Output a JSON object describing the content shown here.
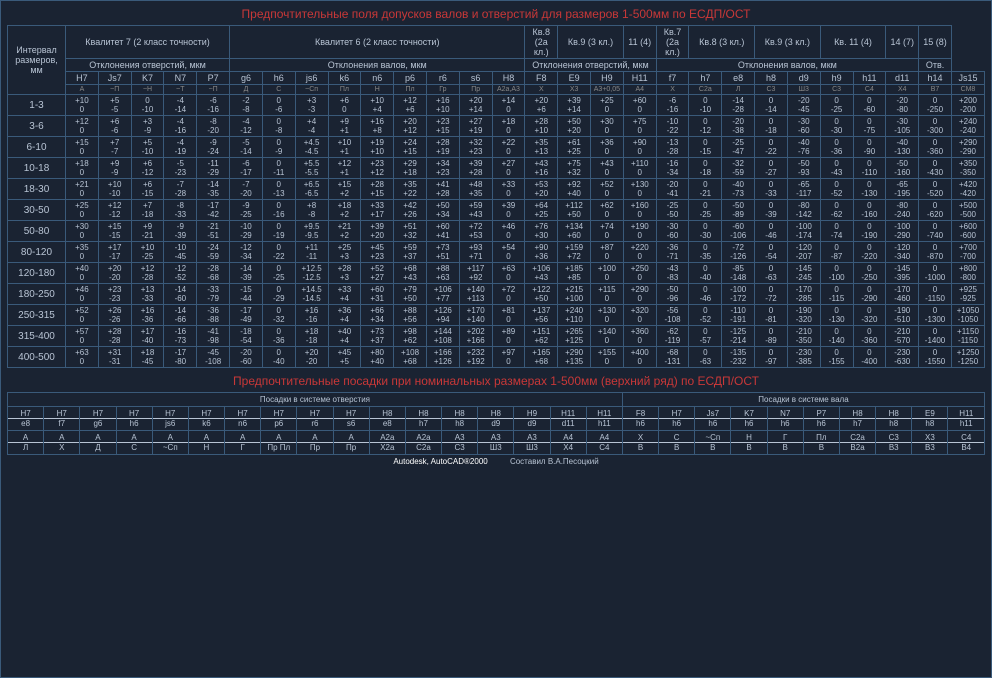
{
  "title_top": "Предпочтительные поля допусков валов и отверстий для размеров 1-500мм по ЕСДП/ОСТ",
  "title_bottom": "Предпочтительные посадки при номинальных размерах 1-500мм (верхний ряд) по ЕСДП/ОСТ",
  "interval_header": "Интервал размеров, мм",
  "quals": [
    {
      "label": "Квалитет 7 (2 класс точности)",
      "sub": "Отклонения отверстий, мкм",
      "span": 5
    },
    {
      "label": "Квалитет 6 (2 класс точности)",
      "sub": "Отклонения валов, мкм",
      "span": 9
    },
    {
      "label": "Кв.8 (2а кл.)",
      "sub": "",
      "span": 1
    },
    {
      "label": "Кв.9 (3 кл.)",
      "sub": "",
      "span": 2
    },
    {
      "label": "11 (4)",
      "sub": "",
      "span": 1
    },
    {
      "label": "Кв.7 (2а кл.)",
      "sub": "",
      "span": 1
    },
    {
      "label": "Кв.8 (3 кл.)",
      "sub": "",
      "span": 2
    },
    {
      "label": "Кв.9 (3 кл.)",
      "sub": "",
      "span": 2
    },
    {
      "label": "Кв. 11 (4)",
      "sub": "",
      "span": 2
    },
    {
      "label": "14 (7)",
      "sub": "",
      "span": 1
    },
    {
      "label": "15 (8)",
      "sub": "",
      "span": 1
    }
  ],
  "dev_holes_span": "Отклонения отверстий, мкм",
  "dev_shafts_span": "Отклонения валов, мкм",
  "otv_label": "Отв.",
  "symbols": [
    "H7",
    "Js7",
    "K7",
    "N7",
    "P7",
    "g6",
    "h6",
    "js6",
    "k6",
    "n6",
    "p6",
    "r6",
    "s6",
    "H8",
    "F8",
    "E9",
    "H9",
    "H11",
    "f7",
    "h7",
    "e8",
    "h8",
    "d9",
    "h9",
    "h11",
    "d11",
    "h14",
    "Js15"
  ],
  "maps": [
    "А",
    "~П",
    "~Н",
    "~Т",
    "~П",
    "Д",
    "С",
    "~Сп",
    "Пл",
    "Н",
    "Пл",
    "Гр",
    "Пр",
    "А2а,А3",
    "X",
    "X3",
    "А3+0,05",
    "А4",
    "X",
    "С2а",
    "Л",
    "С3",
    "Ш3",
    "С3",
    "С4",
    "X4",
    "В7",
    "СМ8"
  ],
  "intervals": [
    "1-3",
    "3-6",
    "6-10",
    "10-18",
    "18-30",
    "30-50",
    "50-80",
    "80-120",
    "120-180",
    "180-250",
    "250-315",
    "315-400",
    "400-500"
  ],
  "chart_data": {
    "type": "table",
    "rows": [
      [
        "+10 0",
        "+5 -5",
        "0 -10",
        "-4 -14",
        "-6 -16",
        "-2 -8",
        "0 -6",
        "+3 -3",
        "+6 0",
        "+10 +4",
        "+12 +6",
        "+16 +10",
        "+20 +14",
        "+14 0",
        "+20 +6",
        "+39 +14",
        "+25 0",
        "+60 0",
        "-6 -16",
        "0 -10",
        "-14 -28",
        "0 -14",
        "-20 -45",
        "0 -25",
        "0 -60",
        "-20 -80",
        "0 -250",
        "+200 -200"
      ],
      [
        "+12 0",
        "+6 -6",
        "+3 -9",
        "-4 -16",
        "-8 -20",
        "-4 -12",
        "0 -8",
        "+4 -4",
        "+9 +1",
        "+16 +8",
        "+20 +12",
        "+23 +15",
        "+27 +19",
        "+18 0",
        "+28 +10",
        "+50 +20",
        "+30 0",
        "+75 0",
        "-10 -22",
        "0 -12",
        "-20 -38",
        "0 -18",
        "-30 -60",
        "0 -30",
        "0 -75",
        "-30 -105",
        "0 -300",
        "+240 -240"
      ],
      [
        "+15 0",
        "+7 -7",
        "+5 -10",
        "-4 -19",
        "-9 -24",
        "-5 -14",
        "0 -9",
        "+4.5 -4.5",
        "+10 +1",
        "+19 +10",
        "+24 +15",
        "+28 +19",
        "+32 +23",
        "+22 0",
        "+35 +13",
        "+61 +25",
        "+36 0",
        "+90 0",
        "-13 -28",
        "0 -15",
        "-25 -47",
        "0 -22",
        "-40 -76",
        "0 -36",
        "0 -90",
        "-40 -130",
        "0 -360",
        "+290 -290"
      ],
      [
        "+18 0",
        "+9 -9",
        "+6 -12",
        "-5 -23",
        "-11 -29",
        "-6 -17",
        "0 -11",
        "+5.5 -5.5",
        "+12 +1",
        "+23 +12",
        "+29 +18",
        "+34 +23",
        "+39 +28",
        "+27 0",
        "+43 +16",
        "+75 +32",
        "+43 0",
        "+110 0",
        "-16 -34",
        "0 -18",
        "-32 -59",
        "0 -27",
        "-50 -93",
        "0 -43",
        "0 -110",
        "-50 -160",
        "0 -430",
        "+350 -350"
      ],
      [
        "+21 0",
        "+10 -10",
        "+6 -15",
        "-7 -28",
        "-14 -35",
        "-7 -20",
        "0 -13",
        "+6.5 -6.5",
        "+15 +2",
        "+28 +15",
        "+35 +22",
        "+41 +28",
        "+48 +35",
        "+33 0",
        "+53 +20",
        "+92 +40",
        "+52 0",
        "+130 0",
        "-20 -41",
        "0 -21",
        "-40 -73",
        "0 -33",
        "-65 -117",
        "0 -52",
        "0 -130",
        "-65 -195",
        "0 -520",
        "+420 -420"
      ],
      [
        "+25 0",
        "+12 -12",
        "+7 -18",
        "-8 -33",
        "-17 -42",
        "-9 -25",
        "0 -16",
        "+8 -8",
        "+18 +2",
        "+33 +17",
        "+42 +26",
        "+50 +34",
        "+59 +43",
        "+39 0",
        "+64 +25",
        "+112 +50",
        "+62 0",
        "+160 0",
        "-25 -50",
        "0 -25",
        "-50 -89",
        "0 -39",
        "-80 -142",
        "0 -62",
        "0 -160",
        "-80 -240",
        "0 -620",
        "+500 -500"
      ],
      [
        "+30 0",
        "+15 -15",
        "+9 -21",
        "-9 -39",
        "-21 -51",
        "-10 -29",
        "0 -19",
        "+9.5 -9.5",
        "+21 +2",
        "+39 +20",
        "+51 +32",
        "+60 +41",
        "+72 +53",
        "+46 0",
        "+76 +30",
        "+134 +60",
        "+74 0",
        "+190 0",
        "-30 -60",
        "0 -30",
        "-60 -106",
        "0 -46",
        "-100 -174",
        "0 -74",
        "0 -190",
        "-100 -290",
        "0 -740",
        "+600 -600"
      ],
      [
        "+35 0",
        "+17 -17",
        "+10 -25",
        "-10 -45",
        "-24 -59",
        "-12 -34",
        "0 -22",
        "+11 -11",
        "+25 +3",
        "+45 +23",
        "+59 +37",
        "+73 +51",
        "+93 +71",
        "+54 0",
        "+90 +36",
        "+159 +72",
        "+87 0",
        "+220 0",
        "-36 -71",
        "0 -35",
        "-72 -126",
        "0 -54",
        "-120 -207",
        "0 -87",
        "0 -220",
        "-120 -340",
        "0 -870",
        "+700 -700"
      ],
      [
        "+40 0",
        "+20 -20",
        "+12 -28",
        "-12 -52",
        "-28 -68",
        "-14 -39",
        "0 -25",
        "+12.5 -12.5",
        "+28 +3",
        "+52 +27",
        "+68 +43",
        "+88 +63",
        "+117 +92",
        "+63 0",
        "+106 +43",
        "+185 +85",
        "+100 0",
        "+250 0",
        "-43 -83",
        "0 -40",
        "-85 -148",
        "0 -63",
        "-145 -245",
        "0 -100",
        "0 -250",
        "-145 -395",
        "0 -1000",
        "+800 -800"
      ],
      [
        "+46 0",
        "+23 -23",
        "+13 -33",
        "-14 -60",
        "-33 -79",
        "-15 -44",
        "0 -29",
        "+14.5 -14.5",
        "+33 +4",
        "+60 +31",
        "+79 +50",
        "+106 +77",
        "+140 +113",
        "+72 0",
        "+122 +50",
        "+215 +100",
        "+115 0",
        "+290 0",
        "-50 -96",
        "0 -46",
        "-100 -172",
        "0 -72",
        "-170 -285",
        "0 -115",
        "0 -290",
        "-170 -460",
        "0 -1150",
        "+925 -925"
      ],
      [
        "+52 0",
        "+26 -26",
        "+16 -36",
        "-14 -66",
        "-36 -88",
        "-17 -49",
        "0 -32",
        "+16 -16",
        "+36 +4",
        "+66 +34",
        "+88 +56",
        "+126 +94",
        "+170 +140",
        "+81 0",
        "+137 +56",
        "+240 +110",
        "+130 0",
        "+320 0",
        "-56 -108",
        "0 -52",
        "-110 -191",
        "0 -81",
        "-190 -320",
        "0 -130",
        "0 -320",
        "-190 -510",
        "0 -1300",
        "+1050 -1050"
      ],
      [
        "+57 0",
        "+28 -28",
        "+17 -40",
        "-16 -73",
        "-41 -98",
        "-18 -54",
        "0 -36",
        "+18 -18",
        "+40 +4",
        "+73 +37",
        "+98 +62",
        "+144 +108",
        "+202 +166",
        "+89 0",
        "+151 +62",
        "+265 +125",
        "+140 0",
        "+360 0",
        "-62 -119",
        "0 -57",
        "-125 -214",
        "0 -89",
        "-210 -350",
        "0 -140",
        "0 -360",
        "-210 -570",
        "0 -1400",
        "+1150 -1150"
      ],
      [
        "+63 0",
        "+31 -31",
        "+18 -45",
        "-17 -80",
        "-45 -108",
        "-20 -60",
        "0 -40",
        "+20 -20",
        "+45 +5",
        "+80 +40",
        "+108 +68",
        "+166 +126",
        "+232 +192",
        "+97 0",
        "+165 +68",
        "+290 +135",
        "+155 0",
        "+400 0",
        "-68 -131",
        "0 -63",
        "-135 -232",
        "0 -97",
        "-230 -385",
        "0 -155",
        "0 -400",
        "-230 -630",
        "0 -1550",
        "+1250 -1250"
      ]
    ]
  },
  "fits_hole_label": "Посадки в системе отверстия",
  "fits_shaft_label": "Посадки в системе вала",
  "fits_hole_top": [
    {
      "n": "H7",
      "d": "e8"
    },
    {
      "n": "H7",
      "d": "f7"
    },
    {
      "n": "H7",
      "d": "g6"
    },
    {
      "n": "H7",
      "d": "h6"
    },
    {
      "n": "H7",
      "d": "js6"
    },
    {
      "n": "H7",
      "d": "k6"
    },
    {
      "n": "H7",
      "d": "n6"
    },
    {
      "n": "H7",
      "d": "p6"
    },
    {
      "n": "H7",
      "d": "r6"
    },
    {
      "n": "H7",
      "d": "s6"
    },
    {
      "n": "H8",
      "d": "e8"
    },
    {
      "n": "H8",
      "d": "h7"
    },
    {
      "n": "H8",
      "d": "h8"
    },
    {
      "n": "H8",
      "d": "d9"
    },
    {
      "n": "H9",
      "d": "d9"
    },
    {
      "n": "H11",
      "d": "d11"
    },
    {
      "n": "H11",
      "d": "h11"
    }
  ],
  "fits_shaft_top": [
    {
      "n": "F8",
      "d": "h6"
    },
    {
      "n": "H7",
      "d": "h6"
    },
    {
      "n": "Js7",
      "d": "h6"
    },
    {
      "n": "K7",
      "d": "h6"
    },
    {
      "n": "N7",
      "d": "h6"
    },
    {
      "n": "P7",
      "d": "h6"
    },
    {
      "n": "H8",
      "d": "h7"
    },
    {
      "n": "H8",
      "d": "h8"
    },
    {
      "n": "E9",
      "d": "h8"
    },
    {
      "n": "H11",
      "d": "h11"
    }
  ],
  "fits_hole_bot": [
    {
      "n": "А",
      "d": "Л"
    },
    {
      "n": "А",
      "d": "Х"
    },
    {
      "n": "А",
      "d": "Д"
    },
    {
      "n": "А",
      "d": "С"
    },
    {
      "n": "А",
      "d": "~Сп"
    },
    {
      "n": "А",
      "d": "Н"
    },
    {
      "n": "А",
      "d": "Г"
    },
    {
      "n": "А",
      "d": "Пр Пл"
    },
    {
      "n": "А",
      "d": "Пр"
    },
    {
      "n": "А",
      "d": "Пр"
    },
    {
      "n": "А2а",
      "d": "Х2а"
    },
    {
      "n": "А2а",
      "d": "С2а"
    },
    {
      "n": "А3",
      "d": "С3"
    },
    {
      "n": "А3",
      "d": "Ш3"
    },
    {
      "n": "А3",
      "d": "Ш3"
    },
    {
      "n": "А4",
      "d": "Х4"
    },
    {
      "n": "А4",
      "d": "С4"
    }
  ],
  "fits_shaft_bot": [
    {
      "n": "Х",
      "d": "В"
    },
    {
      "n": "С",
      "d": "В"
    },
    {
      "n": "~Сп",
      "d": "В"
    },
    {
      "n": "Н",
      "d": "В"
    },
    {
      "n": "Г",
      "d": "В"
    },
    {
      "n": "Пл",
      "d": "В"
    },
    {
      "n": "С2а",
      "d": "В2а"
    },
    {
      "n": "С3",
      "d": "В3"
    },
    {
      "n": "Х3",
      "d": "В3"
    },
    {
      "n": "С4",
      "d": "В4"
    }
  ],
  "footer_autodesk": "Autodesk, AutoCAD®2000",
  "footer_author": "Составил В.А.Песоцкий"
}
